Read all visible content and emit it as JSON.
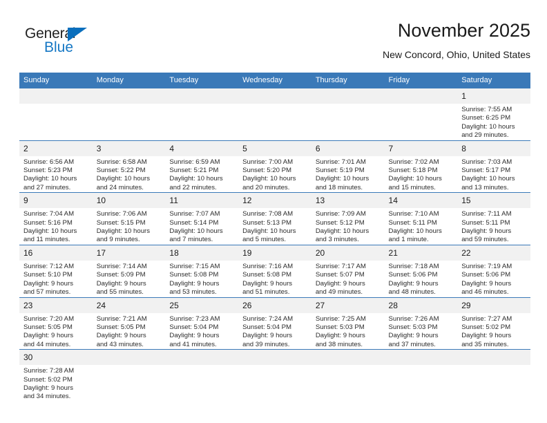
{
  "brand": {
    "name_top": "General",
    "name_bottom": "Blue",
    "triangle_color": "#0a6fbd",
    "blue_text_color": "#1577c4"
  },
  "header": {
    "title": "November 2025",
    "subtitle": "New Concord, Ohio, United States",
    "header_bg_color": "#3a79b8",
    "daynum_bg_color": "#f1f1f1"
  },
  "weekdays": [
    "Sunday",
    "Monday",
    "Tuesday",
    "Wednesday",
    "Thursday",
    "Friday",
    "Saturday"
  ],
  "weeks": [
    [
      {
        "day": "",
        "empty": true
      },
      {
        "day": "",
        "empty": true
      },
      {
        "day": "",
        "empty": true
      },
      {
        "day": "",
        "empty": true
      },
      {
        "day": "",
        "empty": true
      },
      {
        "day": "",
        "empty": true
      },
      {
        "day": "1",
        "sunrise": "Sunrise: 7:55 AM",
        "sunset": "Sunset: 6:25 PM",
        "daylight_1": "Daylight: 10 hours",
        "daylight_2": "and 29 minutes."
      }
    ],
    [
      {
        "day": "2",
        "sunrise": "Sunrise: 6:56 AM",
        "sunset": "Sunset: 5:23 PM",
        "daylight_1": "Daylight: 10 hours",
        "daylight_2": "and 27 minutes."
      },
      {
        "day": "3",
        "sunrise": "Sunrise: 6:58 AM",
        "sunset": "Sunset: 5:22 PM",
        "daylight_1": "Daylight: 10 hours",
        "daylight_2": "and 24 minutes."
      },
      {
        "day": "4",
        "sunrise": "Sunrise: 6:59 AM",
        "sunset": "Sunset: 5:21 PM",
        "daylight_1": "Daylight: 10 hours",
        "daylight_2": "and 22 minutes."
      },
      {
        "day": "5",
        "sunrise": "Sunrise: 7:00 AM",
        "sunset": "Sunset: 5:20 PM",
        "daylight_1": "Daylight: 10 hours",
        "daylight_2": "and 20 minutes."
      },
      {
        "day": "6",
        "sunrise": "Sunrise: 7:01 AM",
        "sunset": "Sunset: 5:19 PM",
        "daylight_1": "Daylight: 10 hours",
        "daylight_2": "and 18 minutes."
      },
      {
        "day": "7",
        "sunrise": "Sunrise: 7:02 AM",
        "sunset": "Sunset: 5:18 PM",
        "daylight_1": "Daylight: 10 hours",
        "daylight_2": "and 15 minutes."
      },
      {
        "day": "8",
        "sunrise": "Sunrise: 7:03 AM",
        "sunset": "Sunset: 5:17 PM",
        "daylight_1": "Daylight: 10 hours",
        "daylight_2": "and 13 minutes."
      }
    ],
    [
      {
        "day": "9",
        "sunrise": "Sunrise: 7:04 AM",
        "sunset": "Sunset: 5:16 PM",
        "daylight_1": "Daylight: 10 hours",
        "daylight_2": "and 11 minutes."
      },
      {
        "day": "10",
        "sunrise": "Sunrise: 7:06 AM",
        "sunset": "Sunset: 5:15 PM",
        "daylight_1": "Daylight: 10 hours",
        "daylight_2": "and 9 minutes."
      },
      {
        "day": "11",
        "sunrise": "Sunrise: 7:07 AM",
        "sunset": "Sunset: 5:14 PM",
        "daylight_1": "Daylight: 10 hours",
        "daylight_2": "and 7 minutes."
      },
      {
        "day": "12",
        "sunrise": "Sunrise: 7:08 AM",
        "sunset": "Sunset: 5:13 PM",
        "daylight_1": "Daylight: 10 hours",
        "daylight_2": "and 5 minutes."
      },
      {
        "day": "13",
        "sunrise": "Sunrise: 7:09 AM",
        "sunset": "Sunset: 5:12 PM",
        "daylight_1": "Daylight: 10 hours",
        "daylight_2": "and 3 minutes."
      },
      {
        "day": "14",
        "sunrise": "Sunrise: 7:10 AM",
        "sunset": "Sunset: 5:11 PM",
        "daylight_1": "Daylight: 10 hours",
        "daylight_2": "and 1 minute."
      },
      {
        "day": "15",
        "sunrise": "Sunrise: 7:11 AM",
        "sunset": "Sunset: 5:11 PM",
        "daylight_1": "Daylight: 9 hours",
        "daylight_2": "and 59 minutes."
      }
    ],
    [
      {
        "day": "16",
        "sunrise": "Sunrise: 7:12 AM",
        "sunset": "Sunset: 5:10 PM",
        "daylight_1": "Daylight: 9 hours",
        "daylight_2": "and 57 minutes."
      },
      {
        "day": "17",
        "sunrise": "Sunrise: 7:14 AM",
        "sunset": "Sunset: 5:09 PM",
        "daylight_1": "Daylight: 9 hours",
        "daylight_2": "and 55 minutes."
      },
      {
        "day": "18",
        "sunrise": "Sunrise: 7:15 AM",
        "sunset": "Sunset: 5:08 PM",
        "daylight_1": "Daylight: 9 hours",
        "daylight_2": "and 53 minutes."
      },
      {
        "day": "19",
        "sunrise": "Sunrise: 7:16 AM",
        "sunset": "Sunset: 5:08 PM",
        "daylight_1": "Daylight: 9 hours",
        "daylight_2": "and 51 minutes."
      },
      {
        "day": "20",
        "sunrise": "Sunrise: 7:17 AM",
        "sunset": "Sunset: 5:07 PM",
        "daylight_1": "Daylight: 9 hours",
        "daylight_2": "and 49 minutes."
      },
      {
        "day": "21",
        "sunrise": "Sunrise: 7:18 AM",
        "sunset": "Sunset: 5:06 PM",
        "daylight_1": "Daylight: 9 hours",
        "daylight_2": "and 48 minutes."
      },
      {
        "day": "22",
        "sunrise": "Sunrise: 7:19 AM",
        "sunset": "Sunset: 5:06 PM",
        "daylight_1": "Daylight: 9 hours",
        "daylight_2": "and 46 minutes."
      }
    ],
    [
      {
        "day": "23",
        "sunrise": "Sunrise: 7:20 AM",
        "sunset": "Sunset: 5:05 PM",
        "daylight_1": "Daylight: 9 hours",
        "daylight_2": "and 44 minutes."
      },
      {
        "day": "24",
        "sunrise": "Sunrise: 7:21 AM",
        "sunset": "Sunset: 5:05 PM",
        "daylight_1": "Daylight: 9 hours",
        "daylight_2": "and 43 minutes."
      },
      {
        "day": "25",
        "sunrise": "Sunrise: 7:23 AM",
        "sunset": "Sunset: 5:04 PM",
        "daylight_1": "Daylight: 9 hours",
        "daylight_2": "and 41 minutes."
      },
      {
        "day": "26",
        "sunrise": "Sunrise: 7:24 AM",
        "sunset": "Sunset: 5:04 PM",
        "daylight_1": "Daylight: 9 hours",
        "daylight_2": "and 39 minutes."
      },
      {
        "day": "27",
        "sunrise": "Sunrise: 7:25 AM",
        "sunset": "Sunset: 5:03 PM",
        "daylight_1": "Daylight: 9 hours",
        "daylight_2": "and 38 minutes."
      },
      {
        "day": "28",
        "sunrise": "Sunrise: 7:26 AM",
        "sunset": "Sunset: 5:03 PM",
        "daylight_1": "Daylight: 9 hours",
        "daylight_2": "and 37 minutes."
      },
      {
        "day": "29",
        "sunrise": "Sunrise: 7:27 AM",
        "sunset": "Sunset: 5:02 PM",
        "daylight_1": "Daylight: 9 hours",
        "daylight_2": "and 35 minutes."
      }
    ],
    [
      {
        "day": "30",
        "sunrise": "Sunrise: 7:28 AM",
        "sunset": "Sunset: 5:02 PM",
        "daylight_1": "Daylight: 9 hours",
        "daylight_2": "and 34 minutes."
      },
      {
        "day": "",
        "empty": true
      },
      {
        "day": "",
        "empty": true
      },
      {
        "day": "",
        "empty": true
      },
      {
        "day": "",
        "empty": true
      },
      {
        "day": "",
        "empty": true
      },
      {
        "day": "",
        "empty": true
      }
    ]
  ]
}
